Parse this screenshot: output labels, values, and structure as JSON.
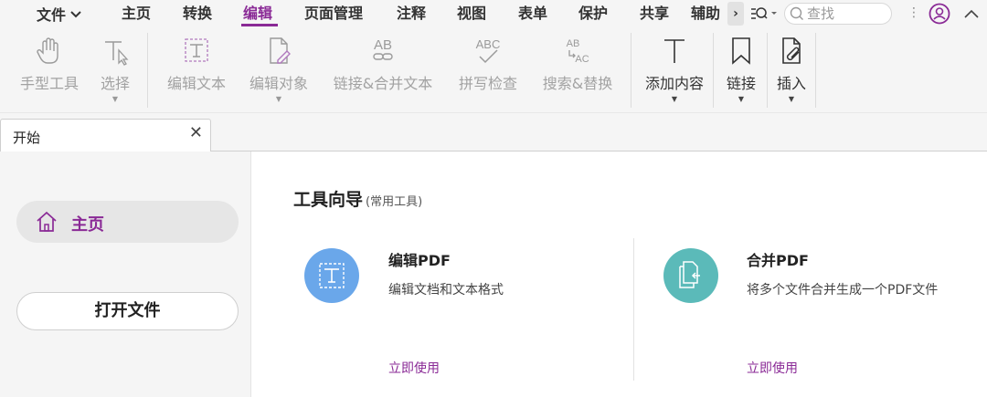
{
  "menu": {
    "items": [
      {
        "label": "文件",
        "has_chevron": true
      },
      {
        "label": "主页"
      },
      {
        "label": "转换"
      },
      {
        "label": "编辑",
        "active": true
      },
      {
        "label": "页面管理"
      },
      {
        "label": "注释"
      },
      {
        "label": "视图"
      },
      {
        "label": "表单"
      },
      {
        "label": "保护"
      },
      {
        "label": "共享"
      },
      {
        "label": "辅助"
      }
    ],
    "more_label": "›",
    "search_placeholder": "查找",
    "dots": "⋮"
  },
  "ribbon": {
    "tools": [
      {
        "label": "手型工具",
        "icon": "hand-icon",
        "enabled": false
      },
      {
        "label": "选择",
        "icon": "select-cursor-icon",
        "enabled": false
      },
      {
        "label": "编辑文本",
        "icon": "edit-text-icon",
        "enabled": false
      },
      {
        "label": "编辑对象",
        "icon": "edit-object-icon",
        "enabled": false
      },
      {
        "label": "链接&合并文本",
        "icon": "link-merge-text-icon",
        "enabled": false
      },
      {
        "label": "拼写检查",
        "icon": "spellcheck-icon",
        "enabled": false
      },
      {
        "label": "搜索&替换",
        "icon": "search-replace-icon",
        "enabled": false
      },
      {
        "label": "添加内容",
        "icon": "add-content-icon",
        "enabled": true
      },
      {
        "label": "链接",
        "icon": "bookmark-link-icon",
        "enabled": true
      },
      {
        "label": "插入",
        "icon": "insert-attachment-icon",
        "enabled": true
      }
    ],
    "icon_text": {
      "link_merge": "AB",
      "spell": "ABC",
      "replace_top": "AB",
      "replace_bottom": "AC"
    }
  },
  "tabs": [
    {
      "label": "开始",
      "close": "✕"
    }
  ],
  "sidebar": {
    "home_label": "主页",
    "open_file_label": "打开文件"
  },
  "main": {
    "section_title": "工具向导",
    "section_subtitle": "(常用工具)",
    "cards": [
      {
        "title": "编辑PDF",
        "desc": "编辑文档和文本格式",
        "link": "立即使用",
        "icon_color": "#6aa7ea"
      },
      {
        "title": "合并PDF",
        "desc": "将多个文件合并生成一个PDF文件",
        "link": "立即使用",
        "icon_color": "#5bbab9"
      }
    ]
  },
  "colors": {
    "accent": "#8a2a96",
    "disabled_text": "#a2a2a2"
  }
}
